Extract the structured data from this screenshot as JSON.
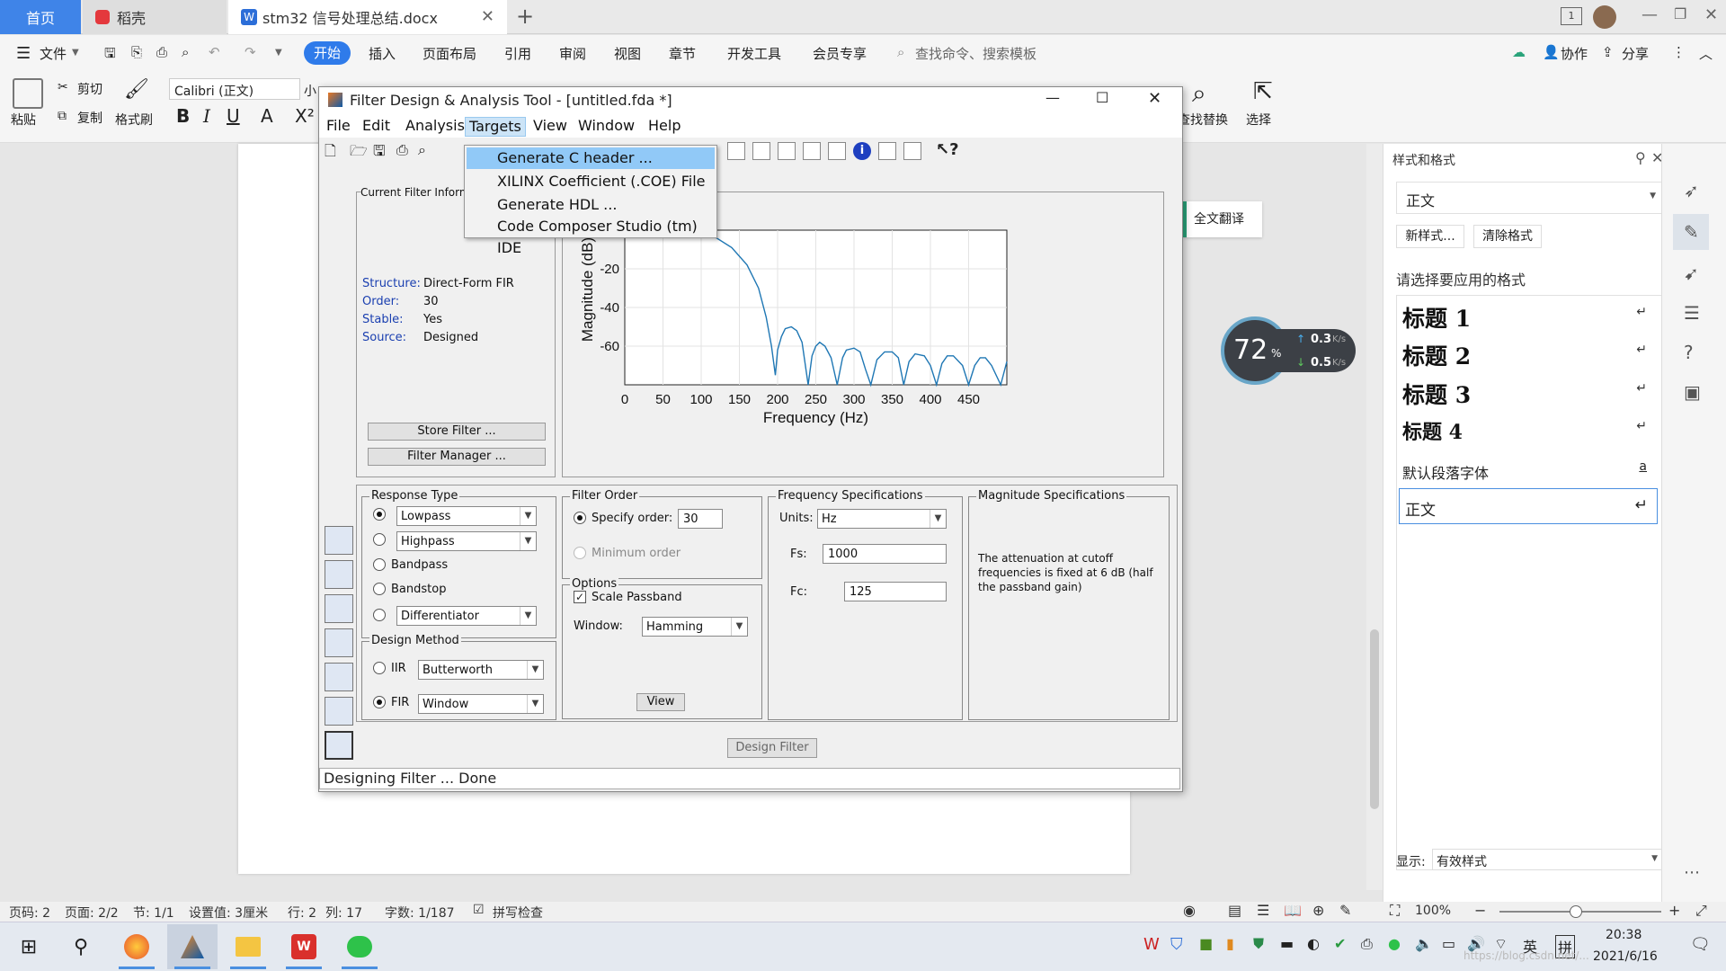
{
  "wps": {
    "tabs": [
      {
        "label": "首页"
      },
      {
        "label": "稻壳"
      },
      {
        "label": "stm32 信号处理总结.docx"
      }
    ],
    "menu": [
      "文件",
      "开始",
      "插入",
      "页面布局",
      "引用",
      "审阅",
      "视图",
      "章节",
      "开发工具",
      "会员专享"
    ],
    "search_placeholder": "查找命令、搜索模板",
    "collab": "协作",
    "share": "分享",
    "ribbon": {
      "paste": "粘贴",
      "cut": "剪切",
      "copy": "复制",
      "format_painter": "格式刷",
      "font": "Calibri (正文)",
      "font_size": "小",
      "find_replace": "查找替换",
      "select": "选择"
    },
    "translate": "全文翻译",
    "style_panel": {
      "title": "样式和格式",
      "current": "正文",
      "new_style": "新样式...",
      "clear": "清除格式",
      "prompt": "请选择要应用的格式",
      "styles": [
        "标题 1",
        "标题 2",
        "标题 3",
        "标题 4"
      ],
      "default_font": "默认段落字体",
      "default_font_mark": "a",
      "body": "正文",
      "show_label": "显示:",
      "show_value": "有效样式"
    },
    "status": {
      "page_code": "页码: 2",
      "pages": "页面: 2/2",
      "section": "节: 1/1",
      "setting": "设置值: 3厘米",
      "row": "行: 2",
      "col": "列: 17",
      "words": "字数: 1/187",
      "spell": "拼写检查",
      "zoom": "100%"
    },
    "netspeed": {
      "percent": "72",
      "unit": "%",
      "up": "0.3",
      "down": "0.5",
      "speed_unit": "K/s"
    }
  },
  "taskbar": {
    "time": "20:38",
    "date": "2021/6/16",
    "lang": "英",
    "ime": "拼",
    "watermark": "https://blog.csdn.net/..."
  },
  "fdatool": {
    "title": "Filter Design & Analysis Tool -  [untitled.fda *]",
    "menu": [
      "File",
      "Edit",
      "Analysis",
      "Targets",
      "View",
      "Window",
      "Help"
    ],
    "targets_menu": [
      "Generate C header ...",
      "XILINX Coefficient (.COE) File",
      "Generate HDL ...",
      "Code Composer Studio (tm) IDE"
    ],
    "current_filter": {
      "title": "Current Filter Inform",
      "rows": [
        {
          "k": "Structure:",
          "v": "Direct-Form FIR"
        },
        {
          "k": "Order:",
          "v": "30"
        },
        {
          "k": "Stable:",
          "v": "Yes"
        },
        {
          "k": "Source:",
          "v": "Designed"
        }
      ],
      "store": "Store Filter ...",
      "manager": "Filter Manager ..."
    },
    "response_type": {
      "title": "Response Type",
      "lowpass": "Lowpass",
      "highpass": "Highpass",
      "bandpass": "Bandpass",
      "bandstop": "Bandstop",
      "differentiator": "Differentiator"
    },
    "design_method": {
      "title": "Design Method",
      "iir": "IIR",
      "iir_value": "Butterworth",
      "fir": "FIR",
      "fir_value": "Window"
    },
    "filter_order": {
      "title": "Filter Order",
      "specify": "Specify order:",
      "value": "30",
      "minimum": "Minimum order"
    },
    "options": {
      "title": "Options",
      "scale": "Scale Passband",
      "window_label": "Window:",
      "window_value": "Hamming",
      "view": "View"
    },
    "freq_spec": {
      "title": "Frequency Specifications",
      "units_label": "Units:",
      "units_value": "Hz",
      "fs_label": "Fs:",
      "fs_value": "1000",
      "fc_label": "Fc:",
      "fc_value": "125"
    },
    "mag_spec": {
      "title": "Magnitude Specifications",
      "text": "The attenuation at cutoff frequencies is fixed at 6 dB (half the passband gain)"
    },
    "design_filter": "Design Filter",
    "status": "Designing Filter ... Done"
  },
  "chart_data": {
    "type": "line",
    "title": "",
    "xlabel": "Frequency (Hz)",
    "ylabel": "Magnitude (dB)",
    "xlim": [
      0,
      500
    ],
    "ylim": [
      -80,
      0
    ],
    "xticks": [
      0,
      50,
      100,
      150,
      200,
      250,
      300,
      350,
      400,
      450
    ],
    "yticks": [
      -20,
      -40,
      -60
    ],
    "grid": true,
    "series": [
      {
        "x": [
          0,
          40,
          80,
          100,
          120,
          140,
          160,
          175,
          185,
          192,
          197,
          200,
          205,
          210,
          218,
          225,
          232,
          240,
          245,
          250,
          255,
          262,
          270,
          278,
          285,
          290,
          300,
          308,
          315,
          322,
          330,
          340,
          350,
          358,
          365,
          372,
          380,
          392,
          400,
          408,
          415,
          422,
          430,
          442,
          450,
          458,
          465,
          472,
          480,
          492,
          500
        ],
        "y": [
          0,
          0,
          -0.5,
          -1.5,
          -4,
          -9,
          -18,
          -30,
          -45,
          -60,
          -75,
          -62,
          -55,
          -51,
          -50,
          -52,
          -58,
          -80,
          -65,
          -60,
          -58,
          -60,
          -66,
          -80,
          -66,
          -62,
          -61,
          -63,
          -72,
          -80,
          -67,
          -63,
          -63,
          -66,
          -80,
          -68,
          -64,
          -65,
          -70,
          -80,
          -69,
          -65,
          -65,
          -70,
          -80,
          -70,
          -66,
          -66,
          -70,
          -80,
          -68
        ]
      }
    ]
  }
}
